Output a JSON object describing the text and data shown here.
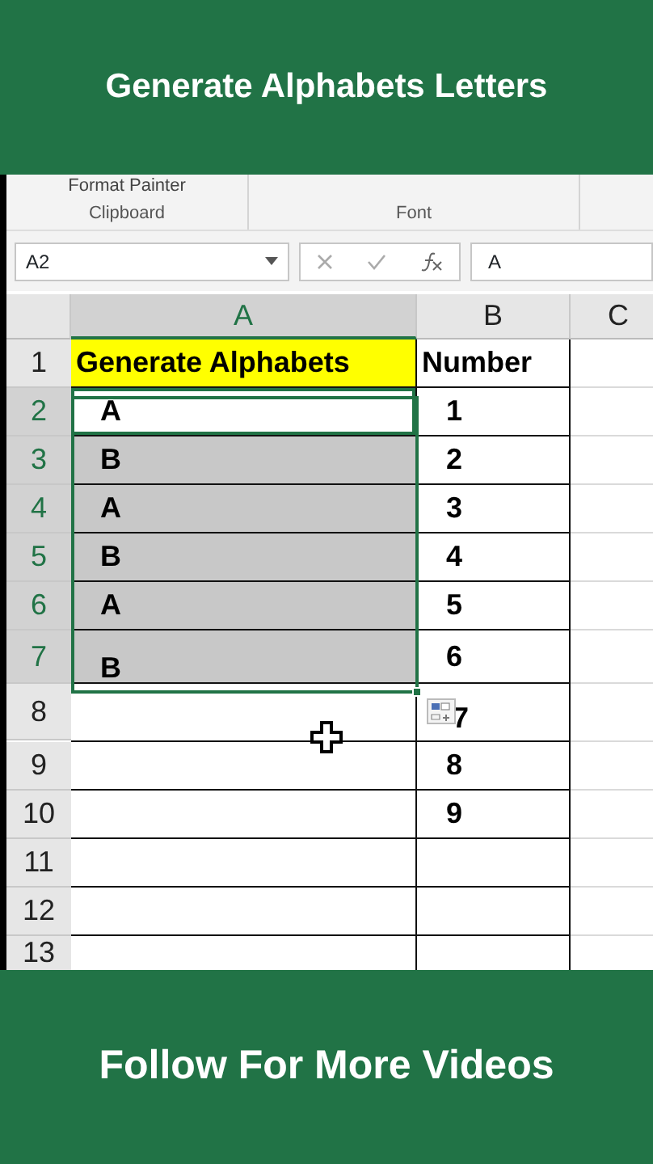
{
  "top_banner": {
    "title": "Generate Alphabets Letters"
  },
  "ribbon": {
    "commands": [
      "Format Painter"
    ],
    "groups": [
      "Clipboard",
      "Font"
    ]
  },
  "formula_bar": {
    "name_box": "A2",
    "value": "A"
  },
  "columns": [
    {
      "label": "A",
      "selected": true
    },
    {
      "label": "B",
      "selected": false
    },
    {
      "label": "C",
      "selected": false
    }
  ],
  "rows": [
    {
      "label": "1",
      "a": "Generate Alphabets",
      "b": "Number",
      "selected": false,
      "active": false,
      "color": "#ffff00"
    },
    {
      "label": "2",
      "a": "A",
      "b": "1",
      "selected": true,
      "active": true
    },
    {
      "label": "3",
      "a": "B",
      "b": "2",
      "selected": true,
      "active": false
    },
    {
      "label": "4",
      "a": "A",
      "b": "3",
      "selected": true,
      "active": false
    },
    {
      "label": "5",
      "a": "B",
      "b": "4",
      "selected": true,
      "active": false
    },
    {
      "label": "6",
      "a": "A",
      "b": "5",
      "selected": true,
      "active": false
    },
    {
      "label": "7",
      "a": "B",
      "b": "6",
      "selected": true,
      "active": false
    },
    {
      "label": "8",
      "b": "7",
      "selected": false,
      "active": false
    },
    {
      "label": "9",
      "b": "8",
      "selected": false,
      "active": false
    },
    {
      "label": "10",
      "b": "9",
      "selected": false,
      "active": false
    },
    {
      "label": "11",
      "selected": false,
      "active": false
    },
    {
      "label": "12",
      "selected": false,
      "active": false
    },
    {
      "label": "13",
      "selected": false,
      "active": false
    }
  ],
  "bottom_banner": {
    "title": "Follow For More Videos"
  }
}
